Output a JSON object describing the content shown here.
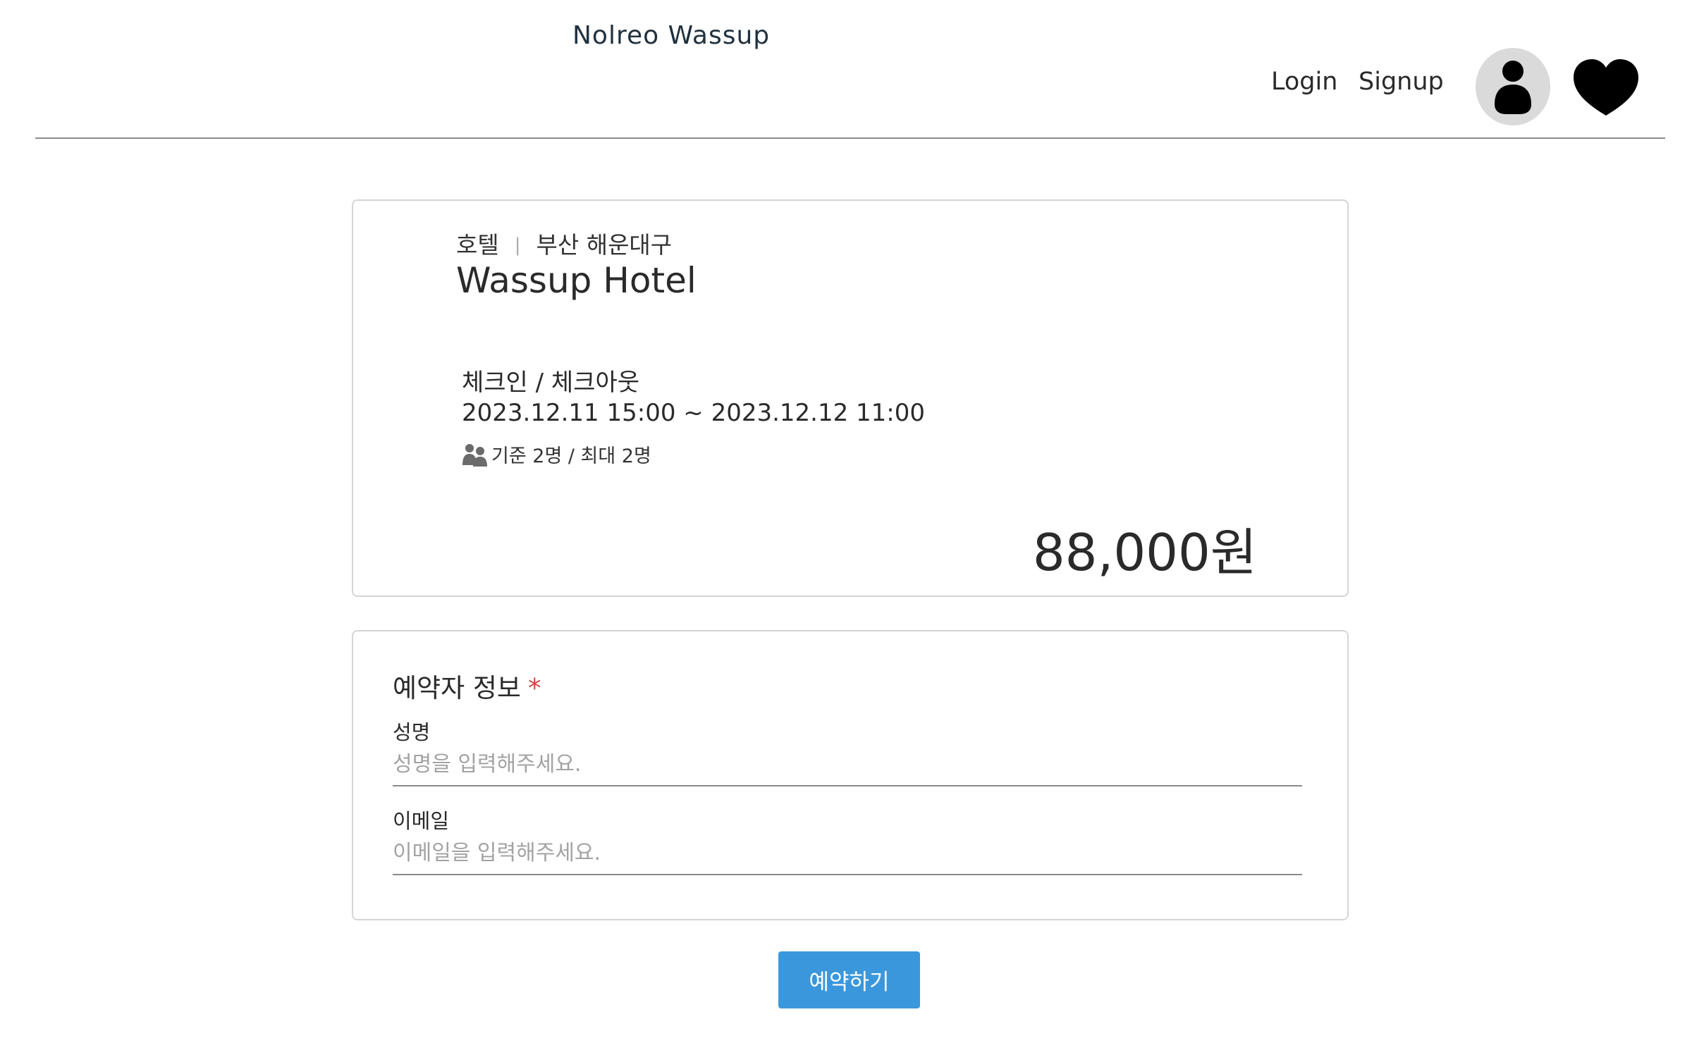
{
  "header": {
    "logo": "Nolreo Wassup",
    "login_label": "Login",
    "signup_label": "Signup"
  },
  "icons": {
    "profile": "user-icon",
    "wishlist": "heart-icon",
    "guests": "users-icon"
  },
  "hotel": {
    "category": "호텔",
    "location": "부산 해운대구",
    "separator": "|",
    "name": "Wassup Hotel",
    "checkin_label": "체크인 / 체크아웃",
    "checkin_range": "2023.12.11 15:00 ~ 2023.12.12 11:00",
    "guests": "기준 2명 / 최대 2명",
    "price": "88,000원"
  },
  "booker": {
    "title": "예약자 정보",
    "required_mark": "*",
    "name_label": "성명",
    "name_placeholder": "성명을 입력해주세요.",
    "name_value": "",
    "email_label": "이메일",
    "email_placeholder": "이메일을 입력해주세요.",
    "email_value": ""
  },
  "submit": {
    "label": "예약하기"
  },
  "colors": {
    "accent": "#3b97dc",
    "required": "#d64545",
    "avatar_bg": "#dadada",
    "divider": "#8e8e8e"
  }
}
